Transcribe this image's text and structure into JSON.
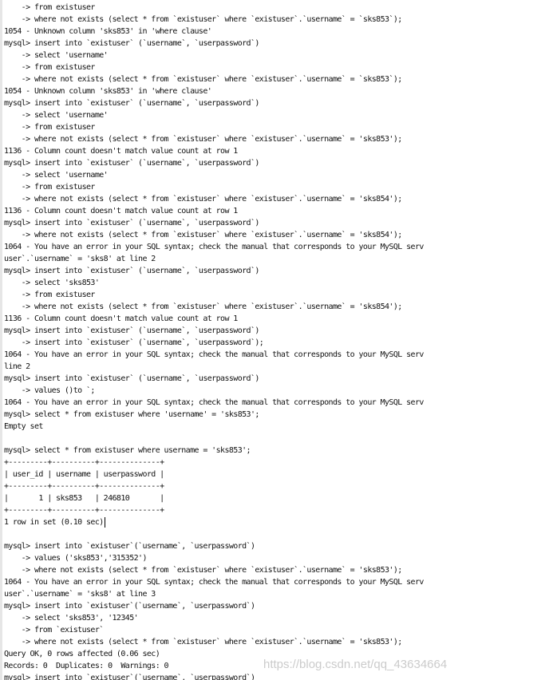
{
  "terminal": {
    "cursor_line": 43,
    "lines": [
      "    -> from existuser",
      "    -> where not exists (select * from `existuser` where `existuser`.`username` = `sks853`);",
      "1054 - Unknown column 'sks853' in 'where clause'",
      "mysql> insert into `existuser` (`username`, `userpassword`)",
      "    -> select 'username'",
      "    -> from existuser",
      "    -> where not exists (select * from `existuser` where `existuser`.`username` = `sks853`);",
      "1054 - Unknown column 'sks853' in 'where clause'",
      "mysql> insert into `existuser` (`username`, `userpassword`)",
      "    -> select 'username'",
      "    -> from existuser",
      "    -> where not exists (select * from `existuser` where `existuser`.`username` = 'sks853');",
      "1136 - Column count doesn't match value count at row 1",
      "mysql> insert into `existuser` (`username`, `userpassword`)",
      "    -> select 'username'",
      "    -> from existuser",
      "    -> where not exists (select * from `existuser` where `existuser`.`username` = 'sks854');",
      "1136 - Column count doesn't match value count at row 1",
      "mysql> insert into `existuser` (`username`, `userpassword`)",
      "    -> where not exists (select * from `existuser` where `existuser`.`username` = 'sks854');",
      "1064 - You have an error in your SQL syntax; check the manual that corresponds to your MySQL serv",
      "user`.`username` = 'sks8' at line 2",
      "mysql> insert into `existuser` (`username`, `userpassword`)",
      "    -> select 'sks853'",
      "    -> from existuser",
      "    -> where not exists (select * from `existuser` where `existuser`.`username` = 'sks854');",
      "1136 - Column count doesn't match value count at row 1",
      "mysql> insert into `existuser` (`username`, `userpassword`)",
      "    -> insert into `existuser` (`username`, `userpassword`);",
      "1064 - You have an error in your SQL syntax; check the manual that corresponds to your MySQL serv",
      "line 2",
      "mysql> insert into `existuser` (`username`, `userpassword`)",
      "    -> values ()to `;",
      "1064 - You have an error in your SQL syntax; check the manual that corresponds to your MySQL serv",
      "mysql> select * from existuser where 'username' = 'sks853';",
      "Empty set",
      "",
      "mysql> select * from existuser where username = 'sks853';",
      "+---------+----------+--------------+",
      "| user_id | username | userpassword |",
      "+---------+----------+--------------+",
      "|       1 | sks853   | 246810       |",
      "+---------+----------+--------------+",
      "1 row in set (0.10 sec)",
      "",
      "mysql> insert into `existuser`(`username`, `userpassword`)",
      "    -> values ('sks853','315352')",
      "    -> where not exists (select * from `existuser` where `existuser`.`username` = 'sks853');",
      "1064 - You have an error in your SQL syntax; check the manual that corresponds to your MySQL serv",
      "user`.`username` = 'sks8' at line 3",
      "mysql> insert into `existuser`(`username`, `userpassword`)",
      "    -> select 'sks853', '12345'",
      "    -> from `existuser`",
      "    -> where not exists (select * from `existuser` where `existuser`.`username` = 'sks853');",
      "Query OK, 0 rows affected (0.06 sec)",
      "Records: 0  Duplicates: 0  Warnings: 0",
      "mysql> insert into `existuser`(`username`, `userpassword`)"
    ]
  },
  "watermark": "https://blog.csdn.net/qq_43634664"
}
